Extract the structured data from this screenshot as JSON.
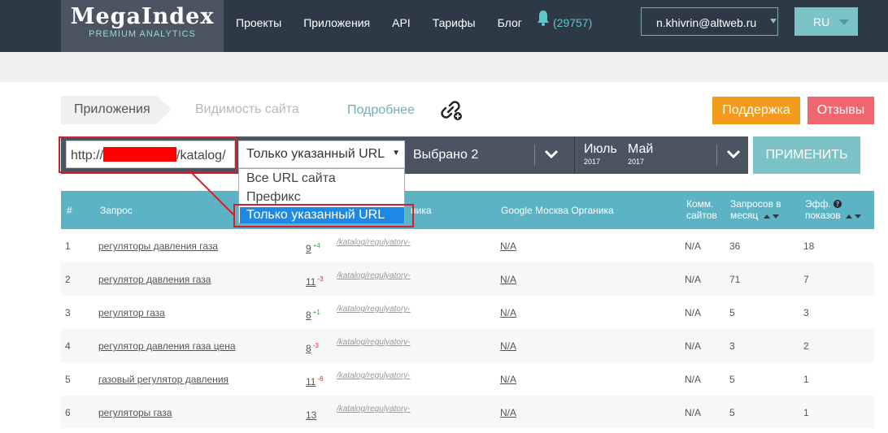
{
  "header": {
    "logo_main": "MegaIndex",
    "logo_sub": "PREMIUM ANALYTICS",
    "nav": [
      "Проекты",
      "Приложения",
      "API",
      "Тарифы",
      "Блог"
    ],
    "notifications": "(29757)",
    "user": "n.khivrin@altweb.ru",
    "lang": "RU"
  },
  "breadcrumb": {
    "item1": "Приложения",
    "item2": "Видимость сайта",
    "more": "Подробнее"
  },
  "actions": {
    "support": "Поддержка",
    "reviews": "Отзывы"
  },
  "filter": {
    "url_prefix": "http://",
    "url_suffix": "/katalog/",
    "url_mode": "Только указанный URL",
    "selected": "Выбрано 2",
    "month1": "Июль",
    "year1": "2017",
    "month2": "Май",
    "year2": "2017",
    "apply": "ПРИМЕНИТЬ",
    "options": [
      "Все URL сайта",
      "Префикс",
      "Только указанный URL"
    ]
  },
  "table": {
    "headers": {
      "num": "#",
      "query": "Запрос",
      "yandex_tail": "ника",
      "google": "Google Москва Органика",
      "competitors_1": "Комм.",
      "competitors_2": "сайтов",
      "requests_1": "Запросов в",
      "requests_2": "месяц",
      "eff_1": "Эфф.",
      "eff_2": "показов"
    },
    "rows": [
      {
        "num": "1",
        "query": "регуляторы давления газа",
        "pos": "9",
        "delta": "+4",
        "url": "/katalog/regulyatory-",
        "google": "N/A",
        "comm": "N/A",
        "requests": "36",
        "eff": "18"
      },
      {
        "num": "2",
        "query": "регулятор давления газа",
        "pos": "11",
        "delta": "-3",
        "url": "/katalog/regulyatory-",
        "google": "N/A",
        "comm": "N/A",
        "requests": "71",
        "eff": "7"
      },
      {
        "num": "3",
        "query": "регулятор газа",
        "pos": "8",
        "delta": "+1",
        "url": "/katalog/regulyatory-",
        "google": "N/A",
        "comm": "N/A",
        "requests": "5",
        "eff": "3"
      },
      {
        "num": "4",
        "query": "регулятор давления газа цена",
        "pos": "8",
        "delta": "-3",
        "url": "/katalog/regulyatory-",
        "google": "N/A",
        "comm": "N/A",
        "requests": "3",
        "eff": "2"
      },
      {
        "num": "5",
        "query": "газовый регулятор давления",
        "pos": "11",
        "delta": "-6",
        "url": "/katalog/regulyatory-",
        "google": "N/A",
        "comm": "N/A",
        "requests": "5",
        "eff": "1"
      },
      {
        "num": "6",
        "query": "регуляторы газа",
        "pos": "13",
        "delta": "",
        "url": "/katalog/regulyatory-",
        "google": "N/A",
        "comm": "N/A",
        "requests": "5",
        "eff": "1"
      }
    ]
  },
  "colors": {
    "topbar": "#2d3a45",
    "accent_teal": "#7cc3c8",
    "table_header": "#5bb3c4",
    "support": "#f29a1b",
    "reviews": "#f0666e",
    "highlight_frame": "#d0202d",
    "selected_option": "#1e88e5"
  },
  "icons": [
    "bell-icon",
    "link-add-icon",
    "chevron-down-icon",
    "sort-arrows-icon",
    "help-icon"
  ]
}
